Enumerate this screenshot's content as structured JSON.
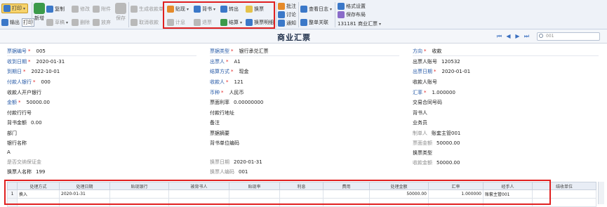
{
  "toolbar": {
    "print": "打印",
    "export": "输出",
    "print_small": "打印",
    "new_label": "新增",
    "copy": "复制",
    "modify": "修改",
    "attach": "附件",
    "save": "保存",
    "draft": "草稿",
    "delete": "删除",
    "abandon": "放弃",
    "gen_voucher": "生成收款单",
    "cancel_voucher": "取消收款",
    "discount": "贴现",
    "endorse": "背书",
    "convert": "转出",
    "exchange": "换票",
    "calc_interest": "计息",
    "return": "退票",
    "settle": "结算",
    "exchange_detail": "换票明细",
    "approve": "批注",
    "discuss": "讨论",
    "notify": "通知",
    "view_log": "查看日志",
    "whole_link": "整单关联",
    "format_settings": "格式设置",
    "save_layout": "保存布局",
    "template": "131181 商业汇票"
  },
  "title": "商业汇票",
  "search_placeholder": "001",
  "fields": {
    "bill_no_label": "票据编号",
    "bill_no": "005",
    "receive_date_label": "收到日期",
    "receive_date": "2020-01-31",
    "due_date_label": "到期日",
    "due_date": "2022-10-01",
    "payer_bank_label": "付款人银行",
    "payer_bank": "000",
    "payee_bank_label": "收款人开户银行",
    "amount_label": "金额",
    "amount": "50000.00",
    "pay_bank_no_label": "付款行行号",
    "endorse_amount_label": "背书金额",
    "endorse_amount": "0.00",
    "dept_label": "部门",
    "bank_name_label": "银行名称",
    "bank_name": "A",
    "deposit_label": "是否交纳保证金",
    "exchanger_label": "换票人名称",
    "exchanger": "199",
    "bill_type_label": "票据类型",
    "bill_type": "银行承兑汇票",
    "drawer_label": "出票人",
    "drawer": "A1",
    "settle_method_label": "结算方式",
    "settle_method": "现金",
    "payee_label": "收款人",
    "payee": "121",
    "currency_label": "币种",
    "currency": "人民币",
    "rate_label": "票面利率",
    "rate": "0.00000000",
    "pay_bank_addr_label": "付款行地址",
    "remark_label": "备注",
    "summary_label": "票据摘要",
    "endorse_unit_label": "背书单位编码",
    "exchange_date_label": "换票日期",
    "exchange_date": "2020-01-31",
    "exchanger_code_label": "换票人编码",
    "exchanger_code": "001",
    "direction_label": "方向",
    "direction": "收款",
    "drawer_acct_label": "出票人账号",
    "drawer_acct": "120532",
    "issue_date_label": "出票日期",
    "issue_date": "2020-01-01",
    "payee_acct_label": "收款人账号",
    "exch_rate_label": "汇率",
    "exch_rate": "1.000000",
    "contract_label": "交易合同号码",
    "endorser_label": "背书人",
    "salesman_label": "业务员",
    "maker_label": "制单人",
    "maker": "账套主管001",
    "face_amount_label": "票面金额",
    "face_amount": "50000.00",
    "exchange_type_label": "换票类型",
    "receipt_amount_label": "收款金额",
    "receipt_amount": "50000.00"
  },
  "grid": {
    "headers": [
      "",
      "处理方式",
      "处理日期",
      "贴现银行",
      "被背书人",
      "贴现率",
      "利息",
      "费用",
      "处理金额",
      "汇率",
      "经手人",
      "结收单位"
    ],
    "rows": [
      [
        "1",
        "换入",
        "2020-01-31",
        "",
        "",
        "",
        "",
        "",
        "50000.00",
        "1.000000",
        "账套主管001",
        ""
      ]
    ]
  }
}
